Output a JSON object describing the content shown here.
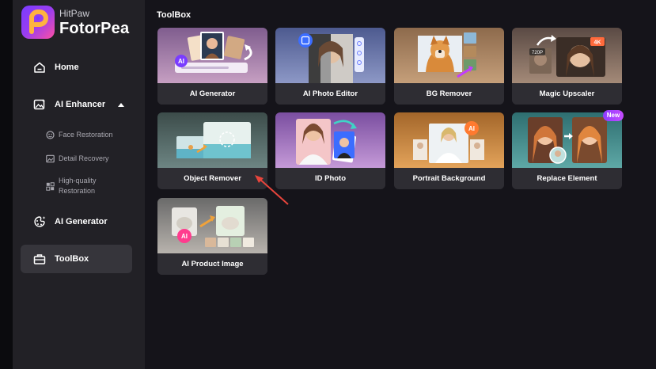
{
  "brand": {
    "small": "HitPaw",
    "name": "FotorPea"
  },
  "nav": {
    "home": "Home",
    "ai_enhancer": "AI Enhancer",
    "ai_generator": "AI Generator",
    "toolbox": "ToolBox"
  },
  "submenu": {
    "face_restoration": "Face Restoration",
    "detail_recovery": "Detail Recovery",
    "hq_restoration_line1": "High-quality",
    "hq_restoration_line2": "Restoration"
  },
  "main": {
    "title": "ToolBox"
  },
  "tools": [
    {
      "label": "AI Generator"
    },
    {
      "label": "AI Photo Editor"
    },
    {
      "label": "BG Remover"
    },
    {
      "label": "Magic Upscaler"
    },
    {
      "label": "Object Remover"
    },
    {
      "label": "ID Photo"
    },
    {
      "label": "Portrait Background"
    },
    {
      "label": "Replace Element"
    },
    {
      "label": "AI Product Image"
    }
  ],
  "badges": {
    "new": "New",
    "ai": "AI",
    "fourk": "4K",
    "p720": "720P"
  },
  "colors": {
    "accent": "#8e3cff",
    "annotation_arrow": "#e8453c",
    "sidebar_bg": "#222126",
    "main_bg": "#15141a",
    "card_bg": "#2e2d33"
  }
}
